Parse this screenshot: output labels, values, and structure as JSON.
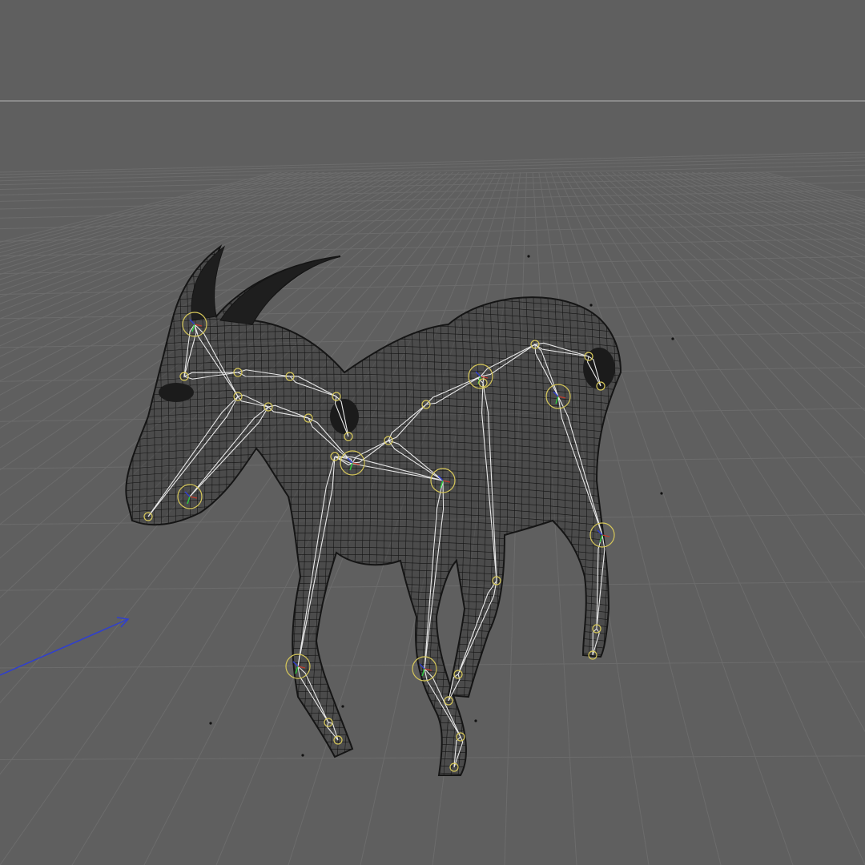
{
  "viewport": {
    "background": "#5f5f5f",
    "grid_color": "#6c6c6c",
    "horizon_line_color": "#8a8a8a",
    "wireframe_color": "#151515",
    "bone_color": "#e8e8e8",
    "joint_color": "#d7c85a",
    "axis_x_color": "#c0392b",
    "axis_y_color": "#2ecc40",
    "axis_z_color": "#2f3fd0",
    "icons": [
      "perspective-grid",
      "world-axis-arrow",
      "goat-mesh",
      "skeleton-rig"
    ]
  }
}
